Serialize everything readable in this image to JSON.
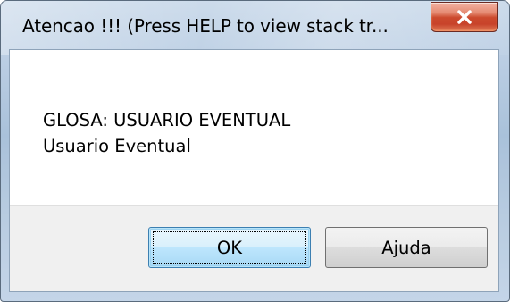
{
  "window": {
    "title": "Atencao !!!  (Press HELP to view stack tr..."
  },
  "message": {
    "line1": "GLOSA: USUARIO EVENTUAL",
    "line2": "Usuario Eventual"
  },
  "buttons": {
    "ok_label": "OK",
    "help_label": "Ajuda"
  },
  "icons": {
    "close": "close-icon"
  },
  "colors": {
    "close_button": "#c8432a",
    "default_button_border": "#3c7fb1",
    "footer_bg": "#f0f0f0"
  }
}
